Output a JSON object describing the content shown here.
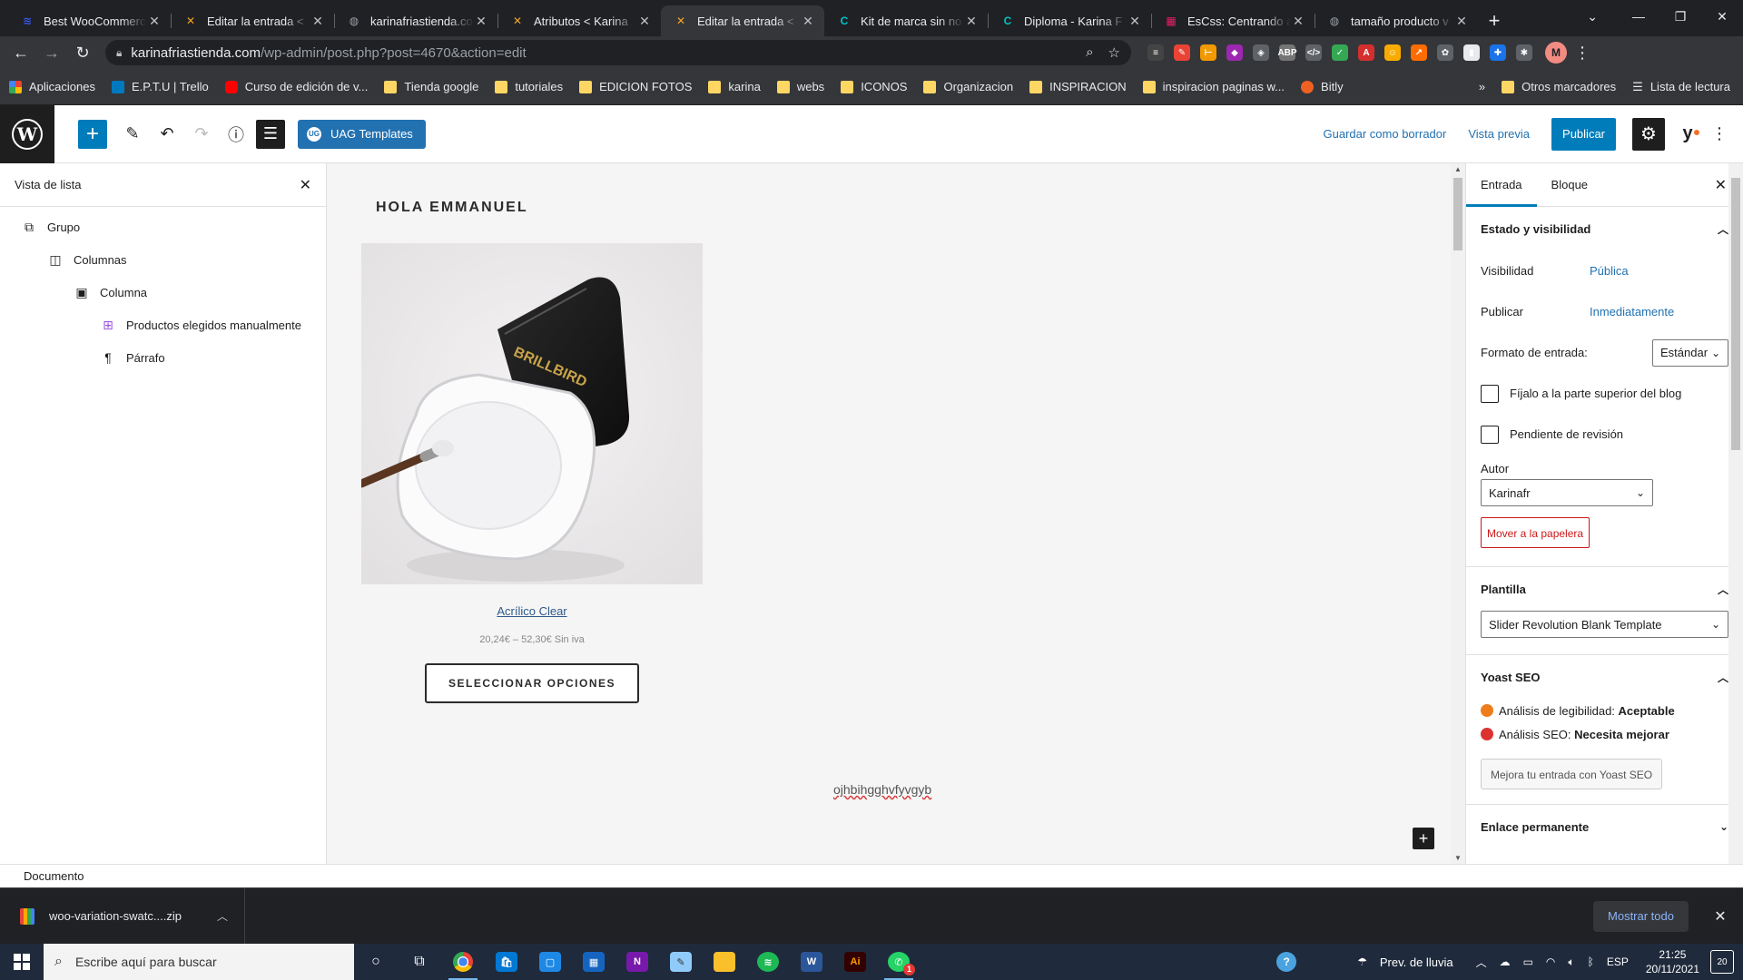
{
  "browser": {
    "tabs": [
      {
        "title": "Best WooCommerce",
        "icon": "stack-icon",
        "color": "#3858e9",
        "glyph": "≋",
        "active": false
      },
      {
        "title": "Editar la entrada <",
        "icon": "astra-icon",
        "color": "#f5a623",
        "glyph": "✕",
        "active": false
      },
      {
        "title": "karinafriastienda.com",
        "icon": "globe-icon",
        "color": "#9aa0a6",
        "glyph": "◍",
        "active": false
      },
      {
        "title": "Atributos < Karina",
        "icon": "astra-icon",
        "color": "#f5a623",
        "glyph": "✕",
        "active": false
      },
      {
        "title": "Editar la entrada <",
        "icon": "astra-icon",
        "color": "#f5a623",
        "glyph": "✕",
        "active": true
      },
      {
        "title": "Kit de marca sin no",
        "icon": "canva-icon",
        "color": "#00c4cc",
        "glyph": "C",
        "active": false
      },
      {
        "title": "Diploma - Karina F",
        "icon": "canva-icon",
        "color": "#00c4cc",
        "glyph": "C",
        "active": false
      },
      {
        "title": "EsCss: Centrando a",
        "icon": "escss-icon",
        "color": "#e91e63",
        "glyph": "▦",
        "active": false
      },
      {
        "title": "tamaño producto v",
        "icon": "globe-icon",
        "color": "#9aa0a6",
        "glyph": "◍",
        "active": false
      }
    ],
    "url_host": "karinafriastienda.com",
    "url_path": "/wp-admin/post.php?post=4670&action=edit",
    "profile_initial": "M",
    "extensions": [
      {
        "name": "buffer-ext-icon",
        "color": "#444",
        "glyph": "≡"
      },
      {
        "name": "pencil-ext-icon",
        "color": "#ea4335",
        "glyph": "✎"
      },
      {
        "name": "ruler-ext-icon",
        "color": "#f29900",
        "glyph": "⊢"
      },
      {
        "name": "color-ext-icon",
        "color": "#9c27b0",
        "glyph": "◆"
      },
      {
        "name": "cube-ext-icon",
        "color": "#5f6368",
        "glyph": "◈"
      },
      {
        "name": "adblock-ext-icon",
        "color": "#757575",
        "glyph": "ABP"
      },
      {
        "name": "code-ext-icon",
        "color": "#5f6368",
        "glyph": "</>"
      },
      {
        "name": "check-ext-icon",
        "color": "#34a853",
        "glyph": "✓"
      },
      {
        "name": "font-ext-icon",
        "color": "#d32f2f",
        "glyph": "A"
      },
      {
        "name": "smile-ext-icon",
        "color": "#f9ab00",
        "glyph": "☺"
      },
      {
        "name": "chart-ext-icon",
        "color": "#ff6d00",
        "glyph": "↗"
      },
      {
        "name": "flower-ext-icon",
        "color": "#5f6368",
        "glyph": "✿"
      },
      {
        "name": "card-ext-icon",
        "color": "#e8eaed",
        "glyph": "▮"
      },
      {
        "name": "plus-ext-icon",
        "color": "#1a73e8",
        "glyph": "✚"
      },
      {
        "name": "puzzle-ext-icon",
        "color": "#5f6368",
        "glyph": "✱"
      }
    ],
    "bookmarks": [
      {
        "label": "Aplicaciones",
        "type": "apps"
      },
      {
        "label": "E.P.T.U | Trello",
        "type": "trello"
      },
      {
        "label": "Curso de edición de v...",
        "type": "youtube"
      },
      {
        "label": "Tienda google",
        "type": "folder"
      },
      {
        "label": "tutoriales",
        "type": "folder"
      },
      {
        "label": "EDICION FOTOS",
        "type": "folder"
      },
      {
        "label": "karina",
        "type": "folder"
      },
      {
        "label": "webs",
        "type": "folder"
      },
      {
        "label": "ICONOS",
        "type": "folder"
      },
      {
        "label": "Organizacion",
        "type": "folder"
      },
      {
        "label": "INSPIRACION",
        "type": "folder"
      },
      {
        "label": "inspiracion paginas w...",
        "type": "folder"
      },
      {
        "label": "Bitly",
        "type": "bitly"
      }
    ],
    "bookmarks_more": "»",
    "other_bookmarks": "Otros marcadores",
    "reading_list": "Lista de lectura"
  },
  "editor": {
    "uag_label": "UAG Templates",
    "save_draft": "Guardar como borrador",
    "preview": "Vista previa",
    "publish": "Publicar",
    "list_view": {
      "title": "Vista de lista",
      "items": [
        {
          "label": "Grupo",
          "level": 0,
          "icon": "group-block-icon",
          "glyph": "⧉"
        },
        {
          "label": "Columnas",
          "level": 1,
          "icon": "columns-block-icon",
          "glyph": "◫"
        },
        {
          "label": "Columna",
          "level": 2,
          "icon": "column-block-icon",
          "glyph": "▣"
        },
        {
          "label": "Productos elegidos manualmente",
          "level": 3,
          "icon": "products-grid-icon",
          "glyph": "⊞"
        },
        {
          "label": "Párrafo",
          "level": 3,
          "icon": "paragraph-icon",
          "glyph": "¶"
        }
      ]
    },
    "canvas": {
      "greeting": "HOLA EMMANUEL",
      "product_name": "Acrílico Clear",
      "product_price": "20,24€ – 52,30€ Sin iva",
      "select_button": "SELECCIONAR OPCIONES",
      "paragraph": "ojhbihgghvfyvgyb",
      "brand_on_image": "BRILLBIRD"
    },
    "sidebar": {
      "tabs": [
        "Entrada",
        "Bloque"
      ],
      "status_panel": {
        "title": "Estado y visibilidad",
        "visibility_label": "Visibilidad",
        "visibility_value": "Pública",
        "publish_label": "Publicar",
        "publish_value": "Inmediatamente",
        "format_label": "Formato de entrada:",
        "format_value": "Estándar",
        "sticky_label": "Fíjalo a la parte superior del blog",
        "pending_label": "Pendiente de revisión",
        "author_label": "Autor",
        "author_value": "Karinafr",
        "trash_button": "Mover a la papelera"
      },
      "template_panel": {
        "title": "Plantilla",
        "value": "Slider Revolution Blank Template"
      },
      "yoast_panel": {
        "title": "Yoast SEO",
        "readability_label": "Análisis de legibilidad:",
        "readability_value": "Aceptable",
        "readability_color": "#ee7c1b",
        "seo_label": "Análisis SEO:",
        "seo_value": "Necesita mejorar",
        "seo_color": "#dc3232",
        "improve_button": "Mejora tu entrada con Yoast SEO"
      },
      "permalink_panel": {
        "title": "Enlace permanente"
      }
    },
    "footer_breadcrumb": "Documento"
  },
  "downloads": {
    "file": "woo-variation-swatc....zip",
    "show_all": "Mostrar todo"
  },
  "taskbar": {
    "search_placeholder": "Escribe aquí para buscar",
    "weather": "Prev. de lluvia",
    "language": "ESP",
    "time": "21:25",
    "date": "20/11/2021",
    "notifications": "20",
    "whatsapp_badge": "1"
  }
}
